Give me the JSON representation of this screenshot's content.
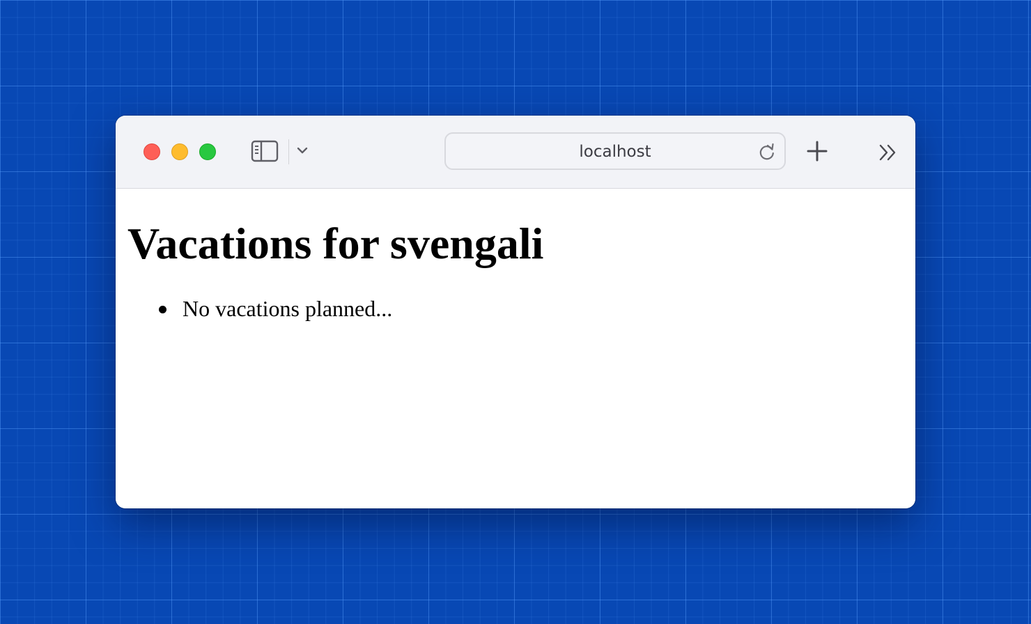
{
  "browser": {
    "address_bar": {
      "url_text": "localhost"
    },
    "icons": {
      "sidebar": "sidebar-icon",
      "tab_group_menu": "chevron-down-icon",
      "back": "chevron-left-icon",
      "forward": "chevron-right-icon",
      "reload": "reload-icon",
      "new_tab": "plus-icon",
      "more": "double-chevron-right-icon"
    },
    "traffic_lights": {
      "close_color": "#fe5f57",
      "minimize_color": "#febc2e",
      "maximize_color": "#28c840"
    }
  },
  "page": {
    "title": "Vacations for svengali",
    "vacations": [
      {
        "label": "No vacations planned..."
      }
    ]
  }
}
